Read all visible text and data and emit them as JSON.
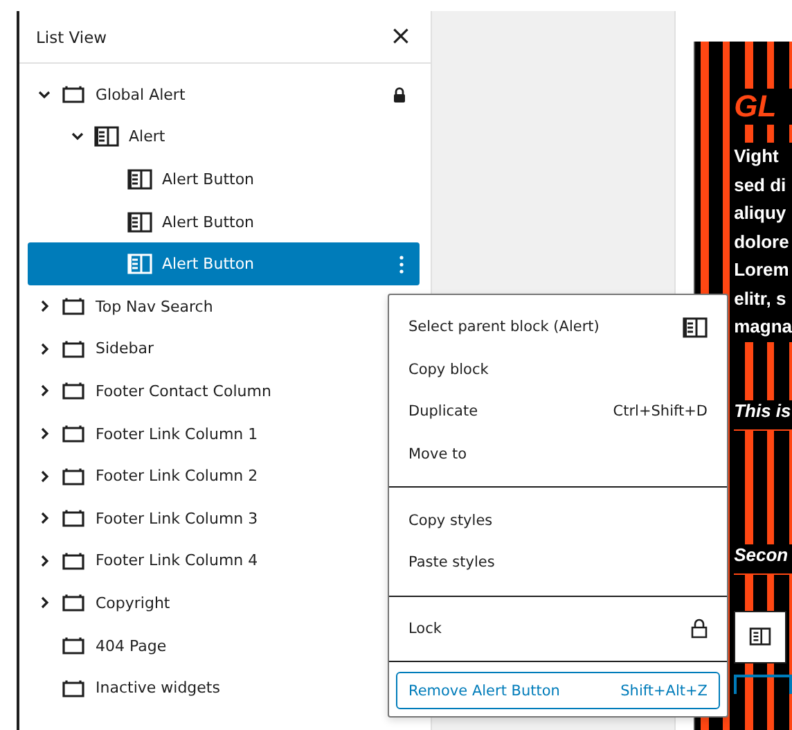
{
  "panel": {
    "title": "List View",
    "close": "×"
  },
  "tree": [
    {
      "label": "Global Alert",
      "kind": "group",
      "expanded": true,
      "locked": true,
      "selected": false,
      "children": [
        {
          "label": "Alert",
          "kind": "columns",
          "expanded": true,
          "locked": false,
          "selected": false,
          "children": [
            {
              "label": "Alert Button",
              "kind": "columns",
              "locked": false,
              "selected": false
            },
            {
              "label": "Alert Button",
              "kind": "columns",
              "locked": false,
              "selected": false
            },
            {
              "label": "Alert Button",
              "kind": "columns",
              "locked": false,
              "selected": true
            }
          ]
        }
      ]
    },
    {
      "label": "Top Nav Search",
      "kind": "group",
      "expanded": false,
      "locked": false,
      "selected": false
    },
    {
      "label": "Sidebar",
      "kind": "group",
      "expanded": false,
      "locked": false,
      "selected": false
    },
    {
      "label": "Footer Contact Column",
      "kind": "group",
      "expanded": false,
      "locked": false,
      "selected": false
    },
    {
      "label": "Footer Link Column 1",
      "kind": "group",
      "expanded": false,
      "locked": false,
      "selected": false
    },
    {
      "label": "Footer Link Column 2",
      "kind": "group",
      "expanded": false,
      "locked": false,
      "selected": false
    },
    {
      "label": "Footer Link Column 3",
      "kind": "group",
      "expanded": false,
      "locked": false,
      "selected": false
    },
    {
      "label": "Footer Link Column 4",
      "kind": "group",
      "expanded": false,
      "locked": false,
      "selected": false
    },
    {
      "label": "Copyright",
      "kind": "group",
      "expanded": false,
      "locked": false,
      "selected": false
    },
    {
      "label": "404 Page",
      "kind": "group",
      "locked": false,
      "selected": false
    },
    {
      "label": "Inactive widgets",
      "kind": "group",
      "locked": false,
      "selected": false
    }
  ],
  "menu": [
    [
      {
        "label": "Select parent block (Alert)",
        "kind": "parent",
        "focused": false
      },
      {
        "label": "Copy block",
        "kind": "plain",
        "focused": false
      },
      {
        "label": "Duplicate",
        "shortcut": "Ctrl+Shift+D",
        "kind": "plain",
        "focused": false
      },
      {
        "label": "Move to",
        "kind": "plain",
        "focused": false
      }
    ],
    [
      {
        "label": "Copy styles",
        "kind": "plain",
        "focused": false
      },
      {
        "label": "Paste styles",
        "kind": "plain",
        "focused": false
      }
    ],
    [
      {
        "label": "Lock",
        "kind": "lock",
        "focused": false
      }
    ],
    [
      {
        "label": "Remove Alert Button",
        "shortcut": "Shift+Alt+Z",
        "kind": "plain",
        "focused": true
      }
    ]
  ],
  "preview": {
    "heading": "GL",
    "paragraph": [
      "Vight",
      "sed di",
      "aliquy",
      "dolore",
      "Lorem",
      "elitr, s",
      "magna"
    ],
    "subheadings": [
      "This is",
      "Secon"
    ]
  }
}
